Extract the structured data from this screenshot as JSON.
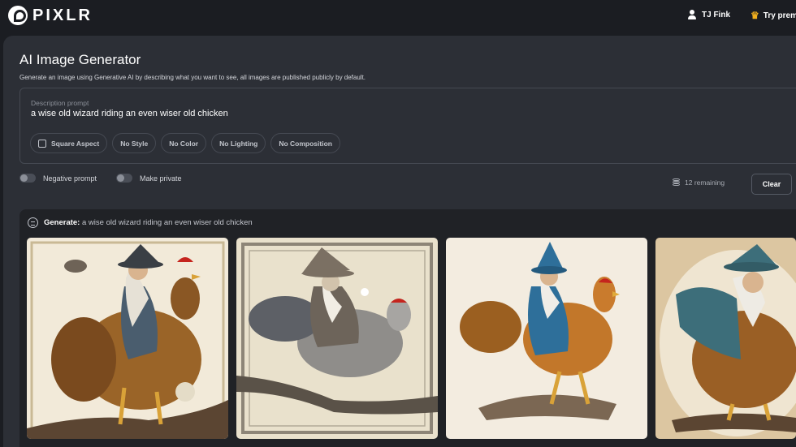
{
  "header": {
    "brand": "PIXLR",
    "user_name": "TJ Fink",
    "premium_label": "Try premium"
  },
  "page": {
    "title": "AI Image Generator",
    "subtitle": "Generate an image using Generative AI by describing what you want to see, all images are published publicly by default."
  },
  "prompt": {
    "label": "Description prompt",
    "value": "a wise old wizard riding an even wiser old chicken"
  },
  "options": {
    "aspect": "Square Aspect",
    "style": "No Style",
    "color": "No Color",
    "lighting": "No Lighting",
    "composition": "No Composition"
  },
  "toggles": {
    "negative_prompt": "Negative prompt",
    "make_private": "Make private"
  },
  "credits": {
    "remaining": "12 remaining"
  },
  "actions": {
    "clear_label": "Clear"
  },
  "generation": {
    "label": "Generate:",
    "prompt": "a wise old wizard riding an even wiser old chicken",
    "image_count": 4
  },
  "colors": {
    "background": "#1b1d22",
    "panel": "#2c2f36",
    "accent_crown": "#f2b01e"
  },
  "icons": [
    "pixlr-logo-icon",
    "user-icon",
    "crown-icon",
    "square-aspect-icon",
    "coins-icon",
    "generate-icon"
  ]
}
